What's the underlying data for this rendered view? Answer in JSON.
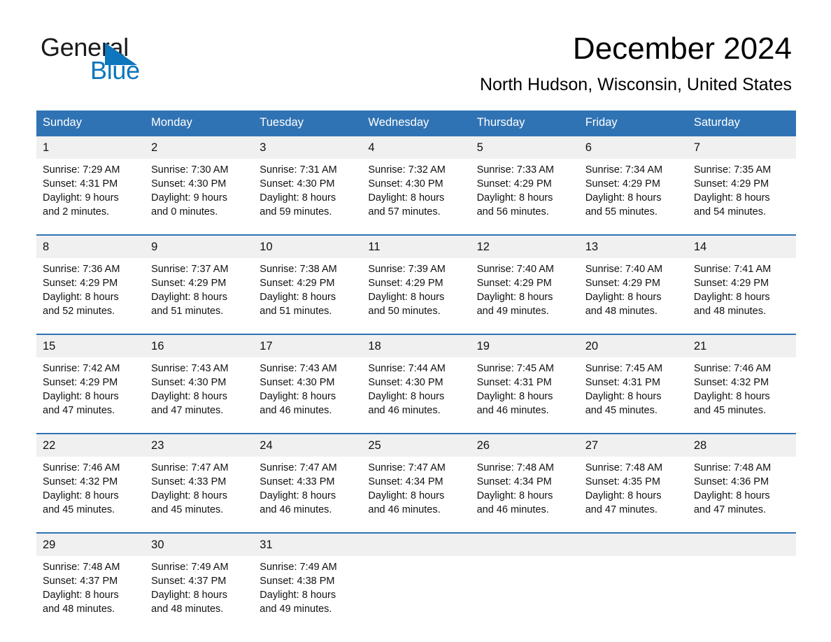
{
  "brand": {
    "name_part1": "General",
    "name_part2": "Blue",
    "triangle_icon": "triangle-icon",
    "accent_blue": "#0e76bc"
  },
  "header": {
    "title": "December 2024",
    "subtitle": "North Hudson, Wisconsin, United States"
  },
  "theme": {
    "header_blue": "#3073b4",
    "daynum_band": "#f0f0f0",
    "text": "#111111"
  },
  "calendar": {
    "weekday_headers": [
      "Sunday",
      "Monday",
      "Tuesday",
      "Wednesday",
      "Thursday",
      "Friday",
      "Saturday"
    ],
    "weeks": [
      [
        {
          "day": "1",
          "sunrise": "Sunrise: 7:29 AM",
          "sunset": "Sunset: 4:31 PM",
          "daylight1": "Daylight: 9 hours",
          "daylight2": "and 2 minutes."
        },
        {
          "day": "2",
          "sunrise": "Sunrise: 7:30 AM",
          "sunset": "Sunset: 4:30 PM",
          "daylight1": "Daylight: 9 hours",
          "daylight2": "and 0 minutes."
        },
        {
          "day": "3",
          "sunrise": "Sunrise: 7:31 AM",
          "sunset": "Sunset: 4:30 PM",
          "daylight1": "Daylight: 8 hours",
          "daylight2": "and 59 minutes."
        },
        {
          "day": "4",
          "sunrise": "Sunrise: 7:32 AM",
          "sunset": "Sunset: 4:30 PM",
          "daylight1": "Daylight: 8 hours",
          "daylight2": "and 57 minutes."
        },
        {
          "day": "5",
          "sunrise": "Sunrise: 7:33 AM",
          "sunset": "Sunset: 4:29 PM",
          "daylight1": "Daylight: 8 hours",
          "daylight2": "and 56 minutes."
        },
        {
          "day": "6",
          "sunrise": "Sunrise: 7:34 AM",
          "sunset": "Sunset: 4:29 PM",
          "daylight1": "Daylight: 8 hours",
          "daylight2": "and 55 minutes."
        },
        {
          "day": "7",
          "sunrise": "Sunrise: 7:35 AM",
          "sunset": "Sunset: 4:29 PM",
          "daylight1": "Daylight: 8 hours",
          "daylight2": "and 54 minutes."
        }
      ],
      [
        {
          "day": "8",
          "sunrise": "Sunrise: 7:36 AM",
          "sunset": "Sunset: 4:29 PM",
          "daylight1": "Daylight: 8 hours",
          "daylight2": "and 52 minutes."
        },
        {
          "day": "9",
          "sunrise": "Sunrise: 7:37 AM",
          "sunset": "Sunset: 4:29 PM",
          "daylight1": "Daylight: 8 hours",
          "daylight2": "and 51 minutes."
        },
        {
          "day": "10",
          "sunrise": "Sunrise: 7:38 AM",
          "sunset": "Sunset: 4:29 PM",
          "daylight1": "Daylight: 8 hours",
          "daylight2": "and 51 minutes."
        },
        {
          "day": "11",
          "sunrise": "Sunrise: 7:39 AM",
          "sunset": "Sunset: 4:29 PM",
          "daylight1": "Daylight: 8 hours",
          "daylight2": "and 50 minutes."
        },
        {
          "day": "12",
          "sunrise": "Sunrise: 7:40 AM",
          "sunset": "Sunset: 4:29 PM",
          "daylight1": "Daylight: 8 hours",
          "daylight2": "and 49 minutes."
        },
        {
          "day": "13",
          "sunrise": "Sunrise: 7:40 AM",
          "sunset": "Sunset: 4:29 PM",
          "daylight1": "Daylight: 8 hours",
          "daylight2": "and 48 minutes."
        },
        {
          "day": "14",
          "sunrise": "Sunrise: 7:41 AM",
          "sunset": "Sunset: 4:29 PM",
          "daylight1": "Daylight: 8 hours",
          "daylight2": "and 48 minutes."
        }
      ],
      [
        {
          "day": "15",
          "sunrise": "Sunrise: 7:42 AM",
          "sunset": "Sunset: 4:29 PM",
          "daylight1": "Daylight: 8 hours",
          "daylight2": "and 47 minutes."
        },
        {
          "day": "16",
          "sunrise": "Sunrise: 7:43 AM",
          "sunset": "Sunset: 4:30 PM",
          "daylight1": "Daylight: 8 hours",
          "daylight2": "and 47 minutes."
        },
        {
          "day": "17",
          "sunrise": "Sunrise: 7:43 AM",
          "sunset": "Sunset: 4:30 PM",
          "daylight1": "Daylight: 8 hours",
          "daylight2": "and 46 minutes."
        },
        {
          "day": "18",
          "sunrise": "Sunrise: 7:44 AM",
          "sunset": "Sunset: 4:30 PM",
          "daylight1": "Daylight: 8 hours",
          "daylight2": "and 46 minutes."
        },
        {
          "day": "19",
          "sunrise": "Sunrise: 7:45 AM",
          "sunset": "Sunset: 4:31 PM",
          "daylight1": "Daylight: 8 hours",
          "daylight2": "and 46 minutes."
        },
        {
          "day": "20",
          "sunrise": "Sunrise: 7:45 AM",
          "sunset": "Sunset: 4:31 PM",
          "daylight1": "Daylight: 8 hours",
          "daylight2": "and 45 minutes."
        },
        {
          "day": "21",
          "sunrise": "Sunrise: 7:46 AM",
          "sunset": "Sunset: 4:32 PM",
          "daylight1": "Daylight: 8 hours",
          "daylight2": "and 45 minutes."
        }
      ],
      [
        {
          "day": "22",
          "sunrise": "Sunrise: 7:46 AM",
          "sunset": "Sunset: 4:32 PM",
          "daylight1": "Daylight: 8 hours",
          "daylight2": "and 45 minutes."
        },
        {
          "day": "23",
          "sunrise": "Sunrise: 7:47 AM",
          "sunset": "Sunset: 4:33 PM",
          "daylight1": "Daylight: 8 hours",
          "daylight2": "and 45 minutes."
        },
        {
          "day": "24",
          "sunrise": "Sunrise: 7:47 AM",
          "sunset": "Sunset: 4:33 PM",
          "daylight1": "Daylight: 8 hours",
          "daylight2": "and 46 minutes."
        },
        {
          "day": "25",
          "sunrise": "Sunrise: 7:47 AM",
          "sunset": "Sunset: 4:34 PM",
          "daylight1": "Daylight: 8 hours",
          "daylight2": "and 46 minutes."
        },
        {
          "day": "26",
          "sunrise": "Sunrise: 7:48 AM",
          "sunset": "Sunset: 4:34 PM",
          "daylight1": "Daylight: 8 hours",
          "daylight2": "and 46 minutes."
        },
        {
          "day": "27",
          "sunrise": "Sunrise: 7:48 AM",
          "sunset": "Sunset: 4:35 PM",
          "daylight1": "Daylight: 8 hours",
          "daylight2": "and 47 minutes."
        },
        {
          "day": "28",
          "sunrise": "Sunrise: 7:48 AM",
          "sunset": "Sunset: 4:36 PM",
          "daylight1": "Daylight: 8 hours",
          "daylight2": "and 47 minutes."
        }
      ],
      [
        {
          "day": "29",
          "sunrise": "Sunrise: 7:48 AM",
          "sunset": "Sunset: 4:37 PM",
          "daylight1": "Daylight: 8 hours",
          "daylight2": "and 48 minutes."
        },
        {
          "day": "30",
          "sunrise": "Sunrise: 7:49 AM",
          "sunset": "Sunset: 4:37 PM",
          "daylight1": "Daylight: 8 hours",
          "daylight2": "and 48 minutes."
        },
        {
          "day": "31",
          "sunrise": "Sunrise: 7:49 AM",
          "sunset": "Sunset: 4:38 PM",
          "daylight1": "Daylight: 8 hours",
          "daylight2": "and 49 minutes."
        },
        {
          "day": "",
          "sunrise": "",
          "sunset": "",
          "daylight1": "",
          "daylight2": ""
        },
        {
          "day": "",
          "sunrise": "",
          "sunset": "",
          "daylight1": "",
          "daylight2": ""
        },
        {
          "day": "",
          "sunrise": "",
          "sunset": "",
          "daylight1": "",
          "daylight2": ""
        },
        {
          "day": "",
          "sunrise": "",
          "sunset": "",
          "daylight1": "",
          "daylight2": ""
        }
      ]
    ]
  }
}
